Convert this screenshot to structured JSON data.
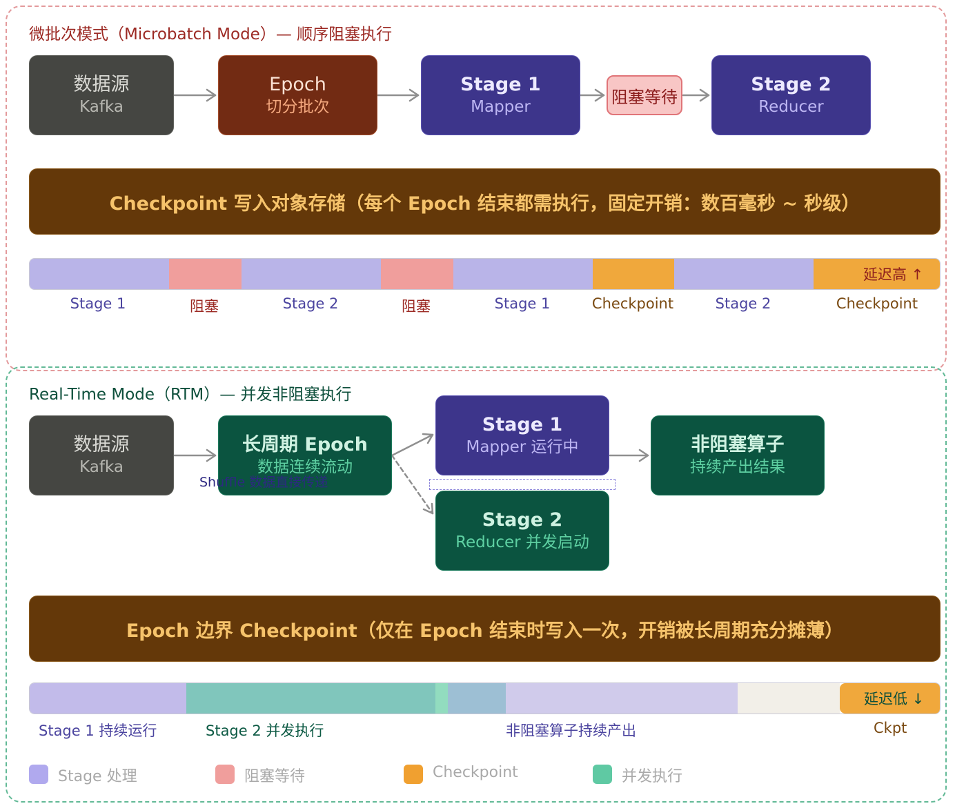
{
  "colors": {
    "stage": "#b9b4e8",
    "blocking": "#f09e9c",
    "checkpoint": "#f0a83c",
    "concurrent": "#5fc9a3"
  },
  "microbatch": {
    "title": "微批次模式（Microbatch Mode）— 顺序阻塞执行",
    "nodes": {
      "source": {
        "title": "数据源",
        "subtitle": "Kafka"
      },
      "epoch": {
        "title": "Epoch",
        "subtitle": "切分批次"
      },
      "stage1": {
        "title": "Stage 1",
        "subtitle": "Mapper"
      },
      "block": {
        "label": "阻塞等待"
      },
      "stage2": {
        "title": "Stage 2",
        "subtitle": "Reducer"
      }
    },
    "checkpoint_banner": "Checkpoint 写入对象存储（每个 Epoch 结束都需执行，固定开销：数百毫秒 ~ 秒级）",
    "timeline": {
      "end_note": "延迟高 ↑",
      "labels": [
        "Stage 1",
        "阻塞",
        "Stage 2",
        "阻塞",
        "Stage 1",
        "Checkpoint",
        "Stage 2",
        "Checkpoint"
      ]
    }
  },
  "rtm": {
    "title": "Real-Time Mode（RTM）— 并发非阻塞执行",
    "nodes": {
      "source": {
        "title": "数据源",
        "subtitle": "Kafka"
      },
      "epoch": {
        "title": "长周期 Epoch",
        "subtitle": "数据连续流动"
      },
      "stage1": {
        "title": "Stage 1",
        "subtitle": "Mapper 运行中"
      },
      "stage2": {
        "title": "Stage 2",
        "subtitle": "Reducer 并发启动"
      },
      "nonblocking": {
        "title": "非阻塞算子",
        "subtitle": "持续产出结果"
      }
    },
    "shuffle_label": "Shuffle 数据直接传递",
    "checkpoint_banner": "Epoch 边界 Checkpoint（仅在 Epoch 结束时写入一次，开销被长周期充分摊薄）",
    "timeline": {
      "end_note": "延迟低 ↓",
      "labels": [
        "Stage 1 持续运行",
        "Stage 2 并发执行",
        "非阻塞算子持续产出",
        "Ckpt"
      ]
    }
  },
  "legend": [
    {
      "label": "Stage 处理",
      "icon": "stage-swatch-icon"
    },
    {
      "label": "阻塞等待",
      "icon": "blocking-swatch-icon"
    },
    {
      "label": "Checkpoint",
      "icon": "checkpoint-swatch-icon"
    },
    {
      "label": "并发执行",
      "icon": "concurrent-swatch-icon"
    }
  ]
}
